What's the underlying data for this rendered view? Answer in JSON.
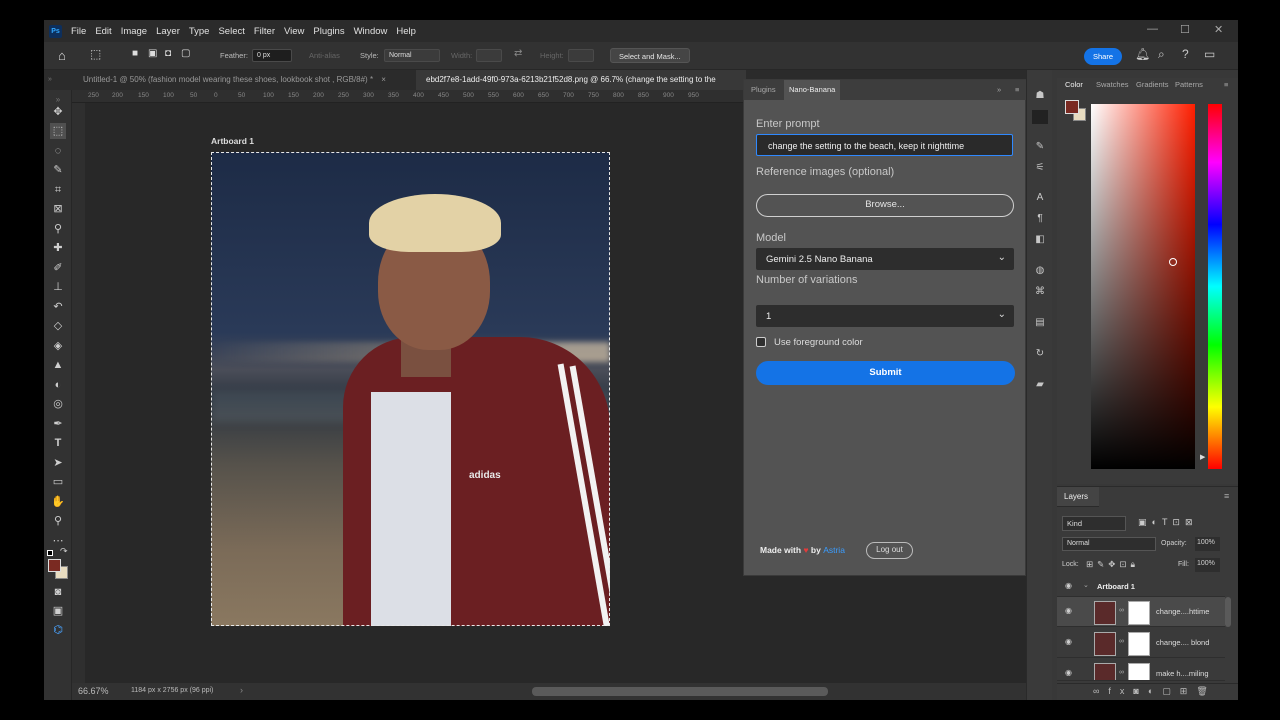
{
  "app": {
    "logo": "Ps"
  },
  "menu": [
    "File",
    "Edit",
    "Image",
    "Layer",
    "Type",
    "Select",
    "Filter",
    "View",
    "Plugins",
    "Window",
    "Help"
  ],
  "window_controls": {
    "minimize": "—",
    "maximize": "☐",
    "close": "✕"
  },
  "options": {
    "feather_label": "Feather:",
    "feather_value": "0 px",
    "antialias": "Anti-alias",
    "style_label": "Style:",
    "style_value": "Normal",
    "width_label": "Width:",
    "height_label": "Height:",
    "select_mask": "Select and Mask...",
    "share": "Share"
  },
  "tabs": [
    {
      "label": "Untitled-1 @ 50% (fashion model wearing these shoes, lookbook shot , RGB/8#) *",
      "close": "×"
    },
    {
      "label": "ebd2f7e8-1add-49f0-973a-6213b21f52d8.png @ 66.7% (change the setting to the"
    }
  ],
  "ruler_ticks": [
    "250",
    "200",
    "150",
    "100",
    "50",
    "0",
    "50",
    "100",
    "150",
    "200",
    "250",
    "300",
    "350",
    "400",
    "450",
    "500",
    "550",
    "600",
    "650",
    "700",
    "750",
    "800",
    "850",
    "900",
    "950"
  ],
  "canvas": {
    "artboard_label": "Artboard 1",
    "brand_text": "adidas"
  },
  "status": {
    "zoom": "66.67%",
    "doc_info": "1184 px x 2756 px (96 ppi)"
  },
  "plugin": {
    "tabs": [
      "Plugins",
      "Nano-Banana"
    ],
    "prompt_label": "Enter prompt",
    "prompt_value": "change the setting to the beach, keep it nighttime",
    "reference_label": "Reference images (optional)",
    "browse": "Browse...",
    "model_label": "Model",
    "model_value": "Gemini 2.5 Nano Banana",
    "variations_label": "Number of variations",
    "variations_value": "1",
    "fg_color_label": "Use foreground color",
    "submit": "Submit",
    "made_with": "Made with",
    "by": "by",
    "brand": "Astria",
    "logout": "Log out"
  },
  "color_panel": {
    "tabs": [
      "Color",
      "Swatches",
      "Gradients",
      "Patterns"
    ],
    "foreground": "#7a2a22",
    "background": "#e8dcc0"
  },
  "layers_panel": {
    "title": "Layers",
    "kind": "Kind",
    "blend": "Normal",
    "opacity_label": "Opacity:",
    "opacity_value": "100%",
    "lock_label": "Lock:",
    "fill_label": "Fill:",
    "fill_value": "100%",
    "group": "Artboard 1",
    "layers": [
      {
        "name": "change....httime"
      },
      {
        "name": "change.... blond"
      },
      {
        "name": "make h....miling"
      }
    ]
  }
}
